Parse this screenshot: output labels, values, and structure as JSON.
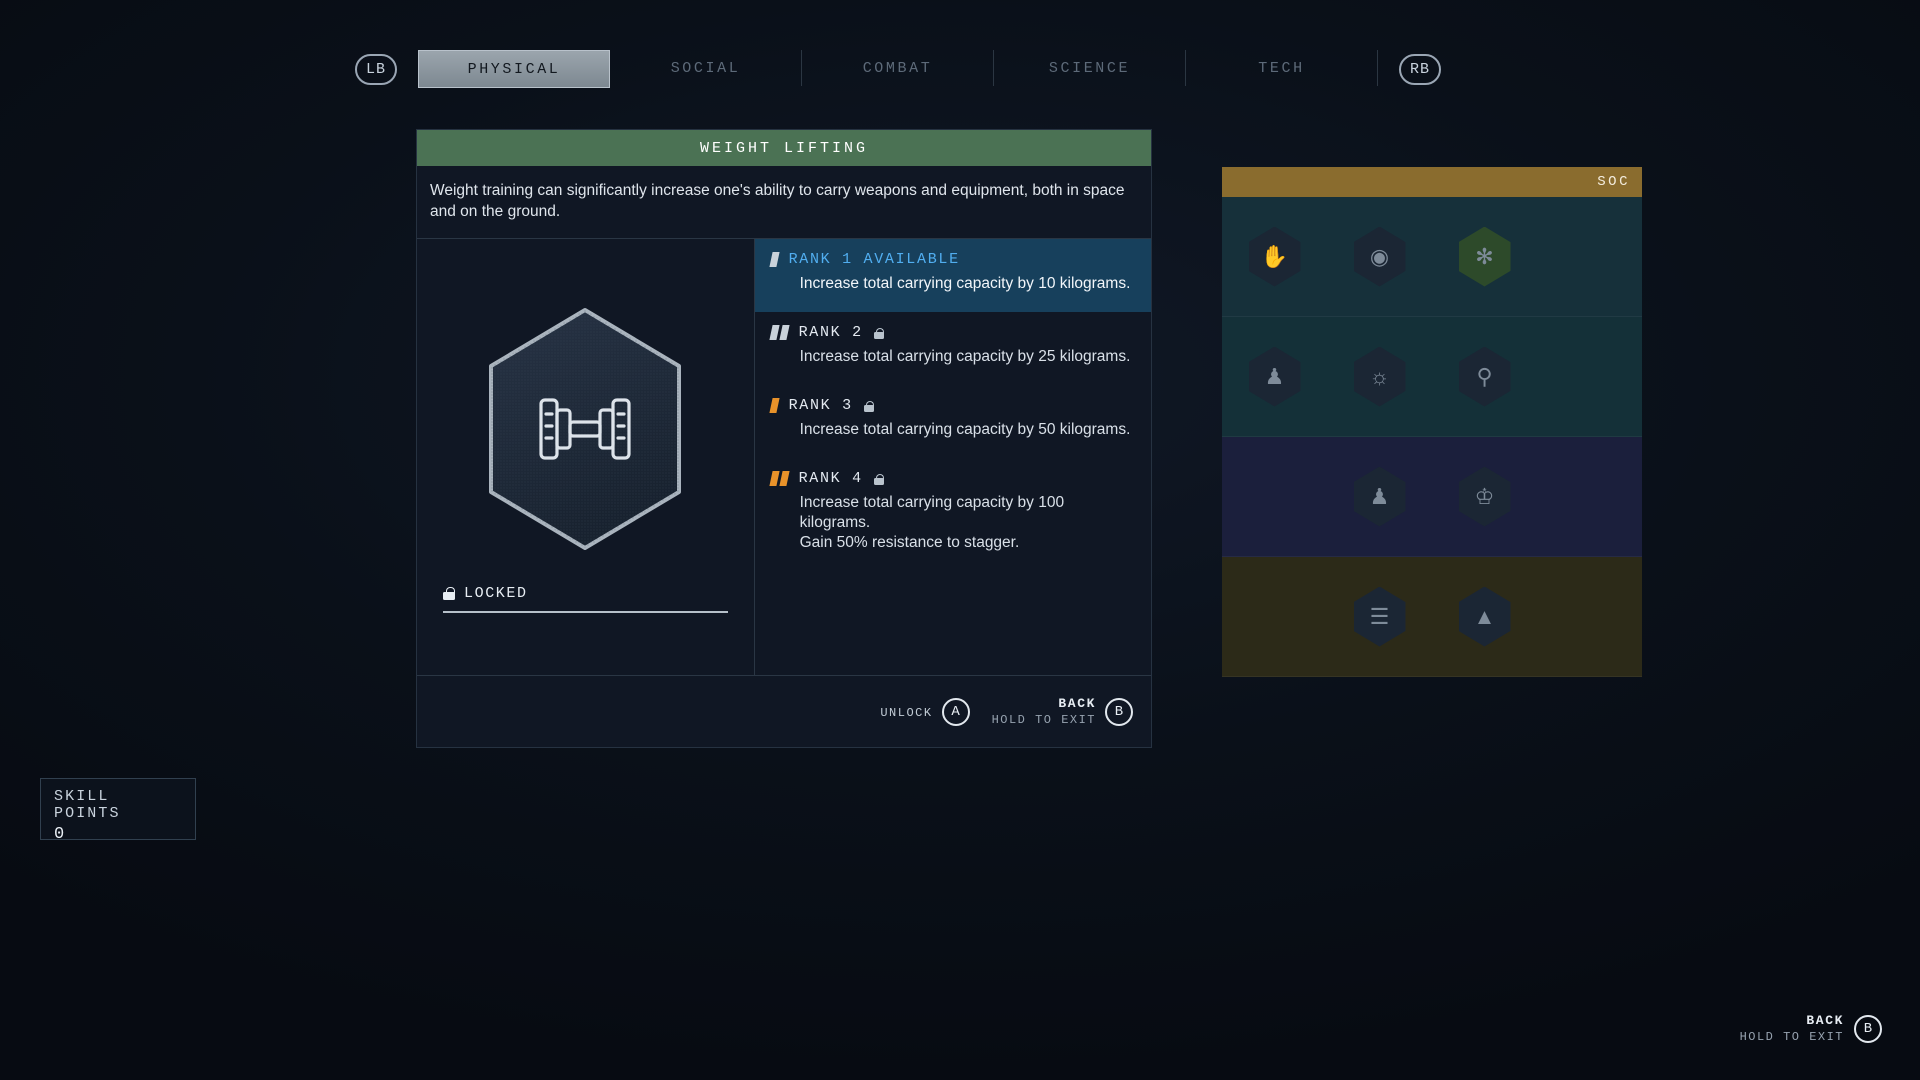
{
  "nav": {
    "left_bumper": "LB",
    "right_bumper": "RB",
    "tabs": [
      {
        "label": "PHYSICAL",
        "active": true
      },
      {
        "label": "SOCIAL",
        "active": false
      },
      {
        "label": "COMBAT",
        "active": false
      },
      {
        "label": "SCIENCE",
        "active": false
      },
      {
        "label": "TECH",
        "active": false
      }
    ]
  },
  "skill": {
    "title": "WEIGHT LIFTING",
    "description": "Weight training can significantly increase one's ability to carry weapons and equipment, both in space and on the ground.",
    "status_label": "LOCKED",
    "icon": "dumbbell-icon",
    "header_color": "#4b7254",
    "ranks": [
      {
        "label": "RANK 1 AVAILABLE",
        "text": "Increase total carrying capacity by 10 kilograms.",
        "pips": 1,
        "pip_color": "#c9d2da",
        "available": true,
        "locked": false
      },
      {
        "label": "RANK 2",
        "text": "Increase total carrying capacity by 25 kilograms.",
        "pips": 2,
        "pip_color": "#c9d2da",
        "available": false,
        "locked": true
      },
      {
        "label": "RANK 3",
        "text": "Increase total carrying capacity by 50 kilograms.",
        "pips": 1,
        "pip_color": "#e8922a",
        "available": false,
        "locked": true
      },
      {
        "label": "RANK 4",
        "text": "Increase total carrying capacity by 100 kilograms.\nGain 50% resistance to stagger.",
        "pips": 2,
        "pip_color": "#e8922a",
        "available": false,
        "locked": true
      }
    ]
  },
  "card_footer": {
    "unlock_label": "UNLOCK",
    "unlock_button": "A",
    "back_label": "BACK",
    "back_sub": "HOLD TO EXIT",
    "back_button": "B"
  },
  "skill_grid": {
    "category_label": "SOC",
    "category_color": "#8a6c2e",
    "rows": [
      {
        "bg": "#16303a",
        "cells": [
          "hand-icon",
          "helmet-icon",
          "plant-icon"
        ]
      },
      {
        "bg": "#143038",
        "cells": [
          "person-icon",
          "handshake-icon",
          "figure-icon"
        ]
      },
      {
        "bg": "#1b1f3c",
        "cells": [
          "",
          "suit-icon",
          "person2-icon"
        ]
      },
      {
        "bg": "#2c2a18",
        "cells": [
          "",
          "tower-icon",
          "monument-icon"
        ]
      }
    ]
  },
  "skill_points": {
    "label": "SKILL POINTS",
    "value": "0"
  },
  "bottom_hint": {
    "main": "BACK",
    "sub": "HOLD TO EXIT",
    "button": "B"
  }
}
